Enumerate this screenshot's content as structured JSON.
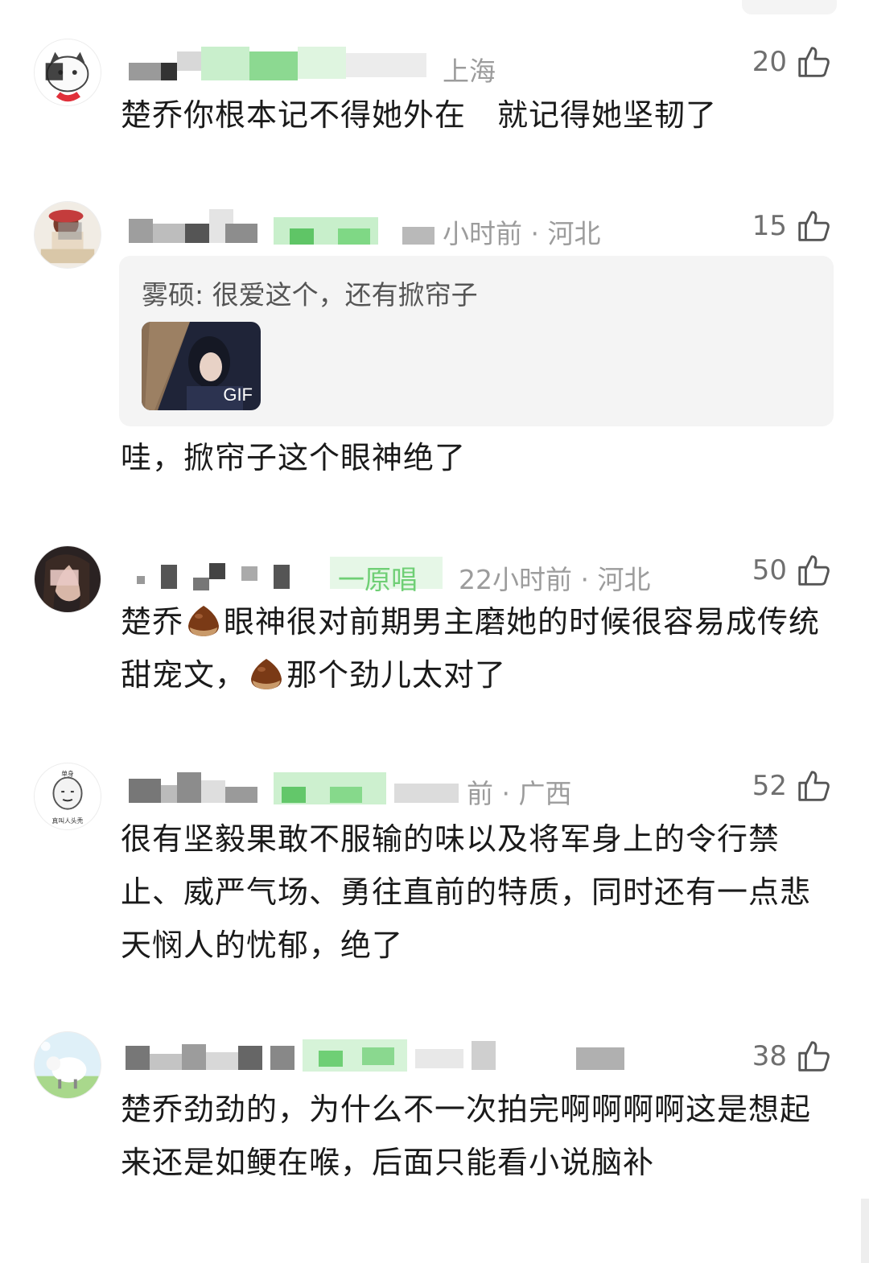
{
  "comments": [
    {
      "meta": "上海",
      "likes": "20",
      "text": "楚乔你根本记不得她外在　就记得她坚韧了"
    },
    {
      "meta": "小时前 · 河北",
      "likes": "15",
      "quote": {
        "author": "雾硕",
        "text": "很爱这个，还有掀帘子",
        "media_label": "GIF"
      },
      "text": "哇，掀帘子这个眼神绝了"
    },
    {
      "badge": "一原唱",
      "meta": "22小时前 · 河北",
      "likes": "50",
      "text_parts": [
        "楚乔",
        "眼神很对前期男主磨她的时候很容易成传统甜宠文，",
        "那个劲儿太对了"
      ]
    },
    {
      "meta": "前 · 广西",
      "likes": "52",
      "avatar_caption": "真叫人头秃",
      "text": "很有坚毅果敢不服输的味以及将军身上的令行禁止、威严气场、勇往直前的特质，同时还有一点悲天悯人的忧郁，绝了"
    },
    {
      "meta": "",
      "likes": "38",
      "text": "楚乔劲劲的，为什么不一次拍完啊啊啊啊这是想起来还是如鲠在喉，后面只能看小说脑补"
    }
  ],
  "icons": {
    "like": "thumbs-up-icon",
    "emoji": "chestnut-emoji-icon"
  },
  "colors": {
    "meta_gray": "#9c9c9c",
    "quote_bg": "#f4f4f4",
    "mosaic_green": "#6fcf75"
  }
}
